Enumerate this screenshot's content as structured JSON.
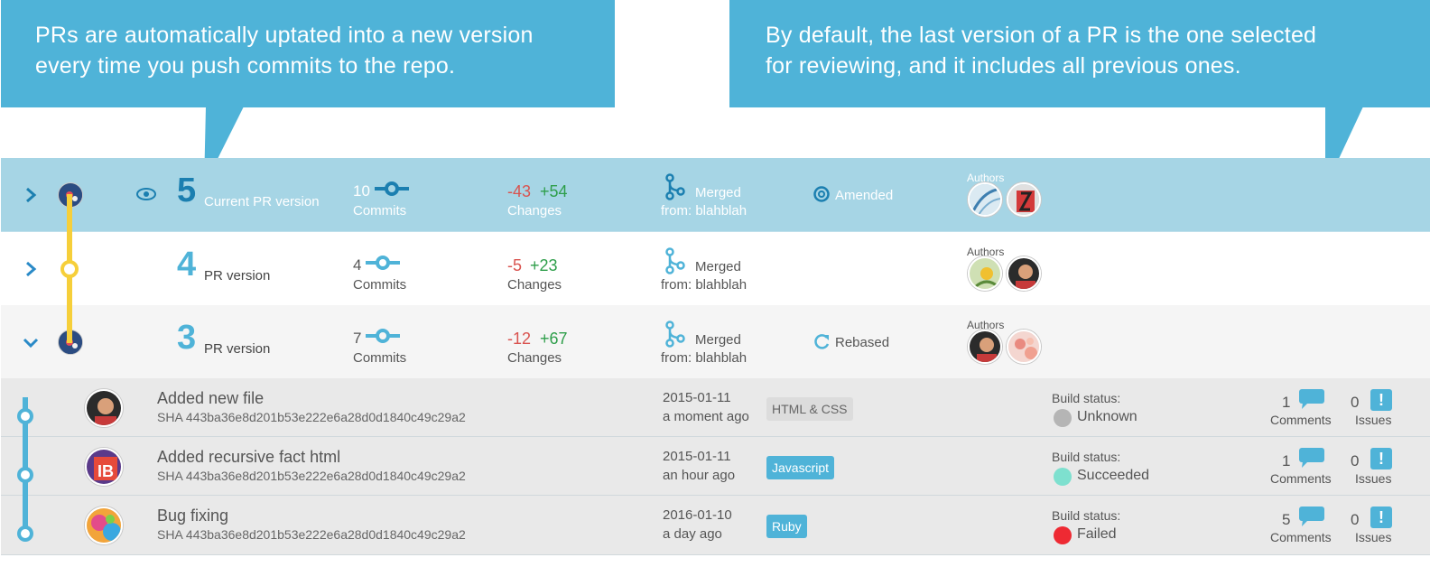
{
  "callouts": {
    "left_line1": "PRs are automatically uptated into a new version",
    "left_line2": "every time you push commits to the repo.",
    "right_line1": "By default, the last version of a PR is the one selected",
    "right_line2": "for reviewing, and it includes all previous ones."
  },
  "versions": [
    {
      "number": "5",
      "label": "Current PR version",
      "commits": "10",
      "commits_label": "Commits",
      "deletions": "-43",
      "additions": "+54",
      "changes_label": "Changes",
      "merged": "Merged",
      "from": "from: blahblah",
      "status": "Amended",
      "authors_label": "Authors"
    },
    {
      "number": "4",
      "label": "PR version",
      "commits": "4",
      "commits_label": "Commits",
      "deletions": "-5",
      "additions": "+23",
      "changes_label": "Changes",
      "merged": "Merged",
      "from": "from: blahblah",
      "status": "",
      "authors_label": "Authors"
    },
    {
      "number": "3",
      "label": "PR version",
      "commits": "7",
      "commits_label": "Commits",
      "deletions": "-12",
      "additions": "+67",
      "changes_label": "Changes",
      "merged": "Merged",
      "from": "from: blahblah",
      "status": "Rebased",
      "authors_label": "Authors"
    }
  ],
  "commits": [
    {
      "title": "Added new file",
      "sha": "SHA 443ba36e8d201b53e222e6a28d0d1840c49c29a2",
      "date": "2015-01-11",
      "ago": "a moment ago",
      "tag": "HTML & CSS",
      "build_label": "Build status:",
      "build_status": "Unknown",
      "build_color": "#b5b5b5",
      "comments": "1",
      "comments_label": "Comments",
      "issues": "0",
      "issues_label": "Issues"
    },
    {
      "title": "Added recursive fact html",
      "sha": "SHA 443ba36e8d201b53e222e6a28d0d1840c49c29a2",
      "date": "2015-01-11",
      "ago": "an hour ago",
      "tag": "Javascript",
      "build_label": "Build status:",
      "build_status": "Succeeded",
      "build_color": "#7ee0cf",
      "comments": "1",
      "comments_label": "Comments",
      "issues": "0",
      "issues_label": "Issues"
    },
    {
      "title": "Bug fixing",
      "sha": "SHA 443ba36e8d201b53e222e6a28d0d1840c49c29a2",
      "date": "2016-01-10",
      "ago": "a day ago",
      "tag": "Ruby",
      "build_label": "Build status:",
      "build_status": "Failed",
      "build_color": "#ee2a33",
      "comments": "5",
      "comments_label": "Comments",
      "issues": "0",
      "issues_label": "Issues"
    }
  ],
  "colors": {
    "accent": "#4fb3d8",
    "current_row": "#a6d5e5",
    "timeline": "#f6cf3a",
    "deletions": "#d9534f",
    "additions": "#2e9e4a"
  }
}
